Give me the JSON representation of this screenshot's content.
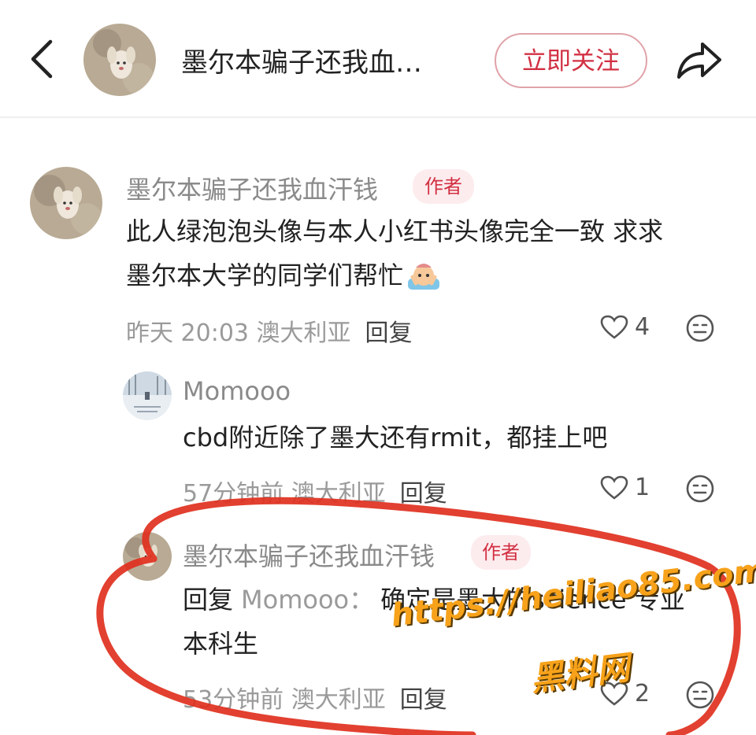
{
  "header": {
    "title": "墨尔本骗子还我血…",
    "follow_label": "立即关注"
  },
  "comments": [
    {
      "author": "墨尔本骗子还我血汗钱",
      "badge": "作者",
      "text_line1": "此人绿泡泡头像与本人小红书头像完全一致 求求",
      "text_line2": "墨尔本大学的同学们帮忙",
      "time_location": "昨天 20:03 澳大利亚",
      "reply_label": "回复",
      "likes": "4"
    },
    {
      "author": "Momooo",
      "text": "cbd附近除了墨大还有rmit，都挂上吧",
      "time_location": "57分钟前 澳大利亚",
      "reply_label": "回复",
      "likes": "1"
    },
    {
      "author": "墨尔本骗子还我血汗钱",
      "badge": "作者",
      "reply_prefix": "回复",
      "reply_to": "Momooo：",
      "text_line1": "确定是墨大的science 专业",
      "text_line2": "本科生",
      "time_location": "53分钟前 澳大利亚",
      "reply_label": "回复",
      "likes": "2"
    }
  ],
  "watermark": {
    "url": "https://heiliao85.com",
    "label": "黑料网"
  },
  "colors": {
    "accent": "#d23143",
    "annotation_circle": "#e0301e",
    "watermark": "#f7a21a"
  }
}
